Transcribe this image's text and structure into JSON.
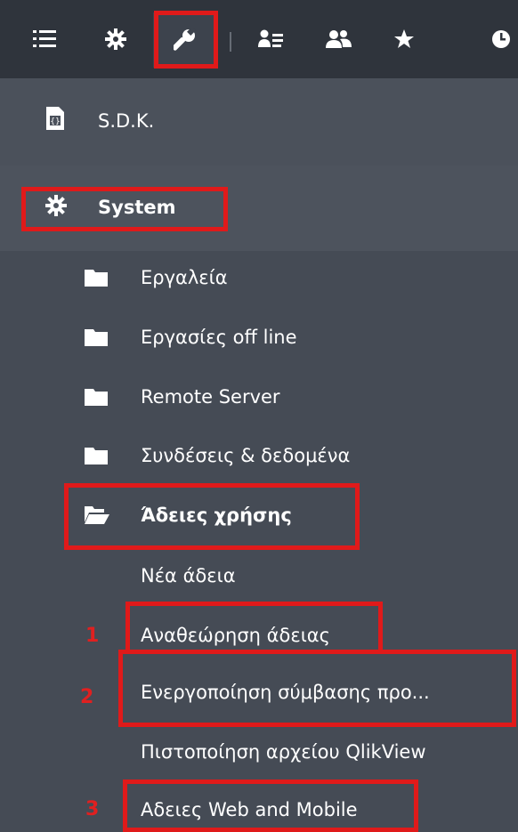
{
  "toolbar": {
    "icons": [
      "list-icon",
      "gear-icon",
      "wrench-icon",
      "user-list-icon",
      "users-icon",
      "star-icon",
      "clock-icon"
    ],
    "active": "wrench-icon"
  },
  "menu": {
    "sdk_label": "S.D.K.",
    "system_label": "System",
    "folders": [
      {
        "label": "Εργαλεία"
      },
      {
        "label": "Εργασίες off line"
      },
      {
        "label": "Remote Server"
      },
      {
        "label": "Συνδέσεις & δεδομένα"
      }
    ],
    "licenses_label": "Άδειες χρήσης",
    "license_items": [
      {
        "label": "Νέα άδεια"
      },
      {
        "label": "Αναθεώρηση άδειας",
        "marker": "1"
      },
      {
        "label": "Ενεργοποίηση σύμβασης προ...",
        "marker": "2"
      },
      {
        "label": "Πιστοποίηση αρχείου QlikView"
      },
      {
        "label": "Αδειες Web and Mobile",
        "marker": "3"
      }
    ]
  },
  "colors": {
    "highlight": "#e01a1a",
    "toolbar_bg": "#2f343c",
    "menu_bg": "#454b55"
  }
}
